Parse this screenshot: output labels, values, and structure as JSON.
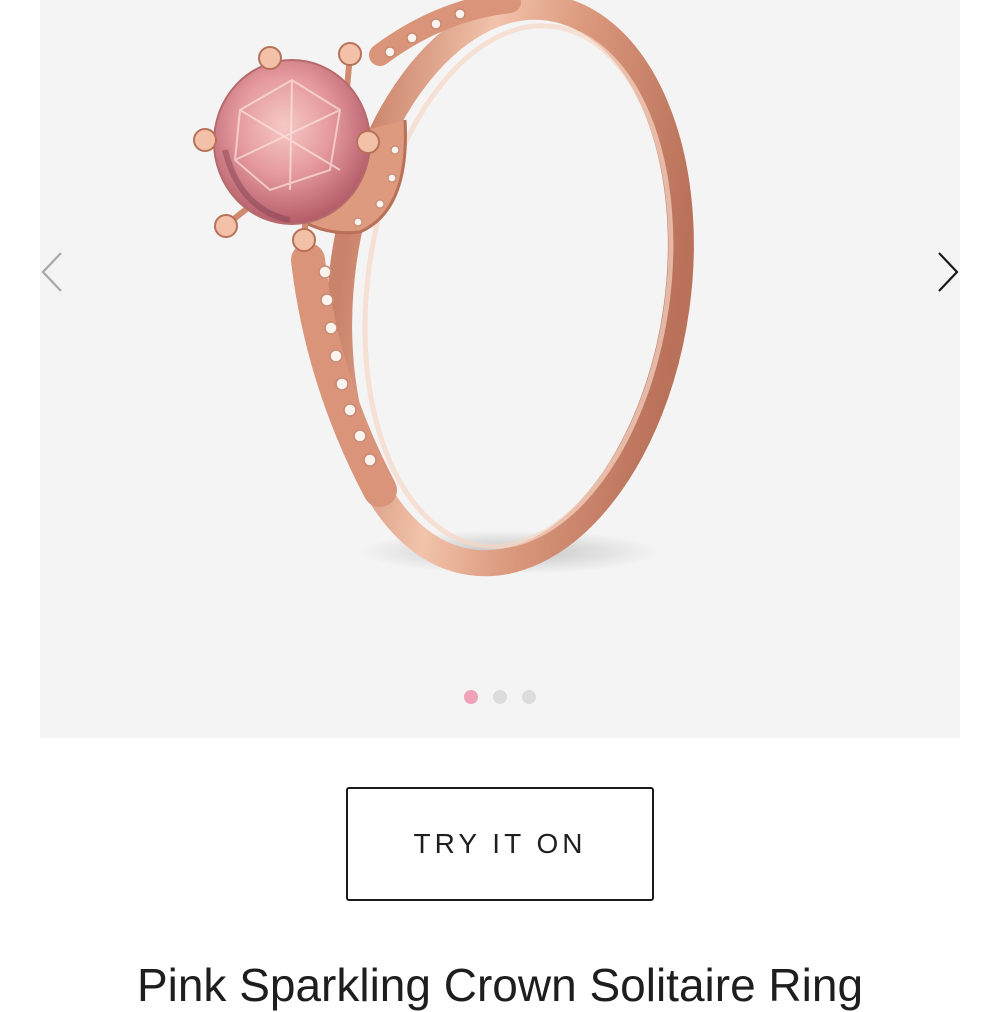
{
  "gallery": {
    "image_subject": "rose-gold-ring-with-pink-stone",
    "prev_icon": "chevron-left-icon",
    "next_icon": "chevron-right-icon",
    "slide_count": 3,
    "active_slide": 1,
    "colors": {
      "background": "#f4f4f4",
      "active_dot": "#f0a3b6",
      "inactive_dot": "#dcdcdc",
      "rose_gold": "#e3a68c",
      "pink_stone": "#e49a9c"
    }
  },
  "actions": {
    "try_on_label": "TRY IT ON"
  },
  "product": {
    "title": "Pink Sparkling Crown Solitaire Ring"
  }
}
